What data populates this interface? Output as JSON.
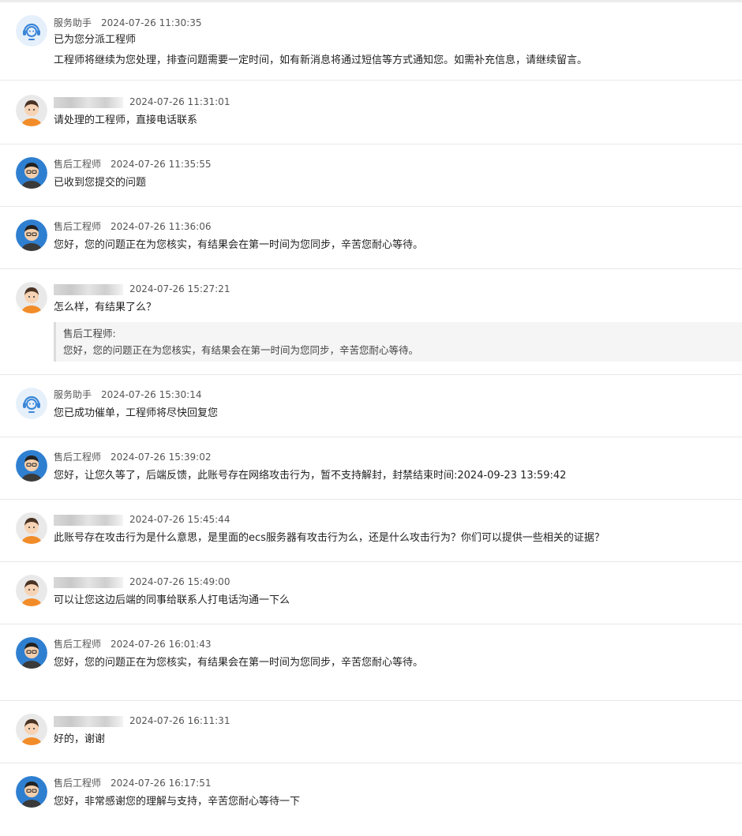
{
  "messages": [
    {
      "sender": "服务助手",
      "time": "2024-07-26 11:30:35",
      "lines": [
        "已为您分派工程师",
        "工程师将继续为您处理，排查问题需要一定时间，如有新消息将通过短信等方式通知您。如需补充信息，请继续留言。"
      ]
    },
    {
      "sender": "",
      "time": "2024-07-26 11:31:01",
      "lines": [
        "请处理的工程师，直接电话联系"
      ]
    },
    {
      "sender": "售后工程师",
      "time": "2024-07-26 11:35:55",
      "lines": [
        "已收到您提交的问题"
      ]
    },
    {
      "sender": "售后工程师",
      "time": "2024-07-26 11:36:06",
      "lines": [
        "您好，您的问题正在为您核实，有结果会在第一时间为您同步，辛苦您耐心等待。"
      ]
    },
    {
      "sender": "",
      "time": "2024-07-26 15:27:21",
      "lines": [
        "怎么样，有结果了么？"
      ],
      "quote": {
        "author": "售后工程师:",
        "text": "您好，您的问题正在为您核实，有结果会在第一时间为您同步，辛苦您耐心等待。"
      }
    },
    {
      "sender": "服务助手",
      "time": "2024-07-26 15:30:14",
      "lines": [
        "您已成功催单，工程师将尽快回复您"
      ]
    },
    {
      "sender": "售后工程师",
      "time": "2024-07-26 15:39:02",
      "lines": [
        "您好，让您久等了，后端反馈，此账号存在网络攻击行为，暂不支持解封，封禁结束时间:2024-09-23 13:59:42"
      ]
    },
    {
      "sender": "",
      "time": "2024-07-26 15:45:44",
      "lines": [
        "此账号存在攻击行为是什么意思，是里面的ecs服务器有攻击行为么，还是什么攻击行为？你们可以提供一些相关的证据？"
      ]
    },
    {
      "sender": "",
      "time": "2024-07-26 15:49:00",
      "lines": [
        "可以让您这边后端的同事给联系人打电话沟通一下么"
      ]
    },
    {
      "sender": "售后工程师",
      "time": "2024-07-26 16:01:43",
      "lines": [
        "您好，您的问题正在为您核实，有结果会在第一时间为您同步，辛苦您耐心等待。"
      ]
    },
    {
      "sender": "",
      "time": "2024-07-26 16:11:31",
      "lines": [
        "好的，谢谢"
      ]
    },
    {
      "sender": "售后工程师",
      "time": "2024-07-26 16:17:51",
      "lines": [
        "您好，非常感谢您的理解与支持，辛苦您耐心等待一下"
      ]
    }
  ],
  "avatar_icons": {
    "assistant": "customer-service-headset-icon",
    "user": "user-avatar-icon",
    "engineer": "engineer-avatar-icon"
  },
  "colors": {
    "assistant_bg": "#e6f0fb",
    "assistant_icon": "#3a86d8",
    "engineer_bg": "#2f7fd1",
    "user_bg": "#e9e9e9",
    "user_shirt": "#f28c28",
    "divider": "#e8e8e8",
    "quote_bg": "#f5f5f5"
  }
}
